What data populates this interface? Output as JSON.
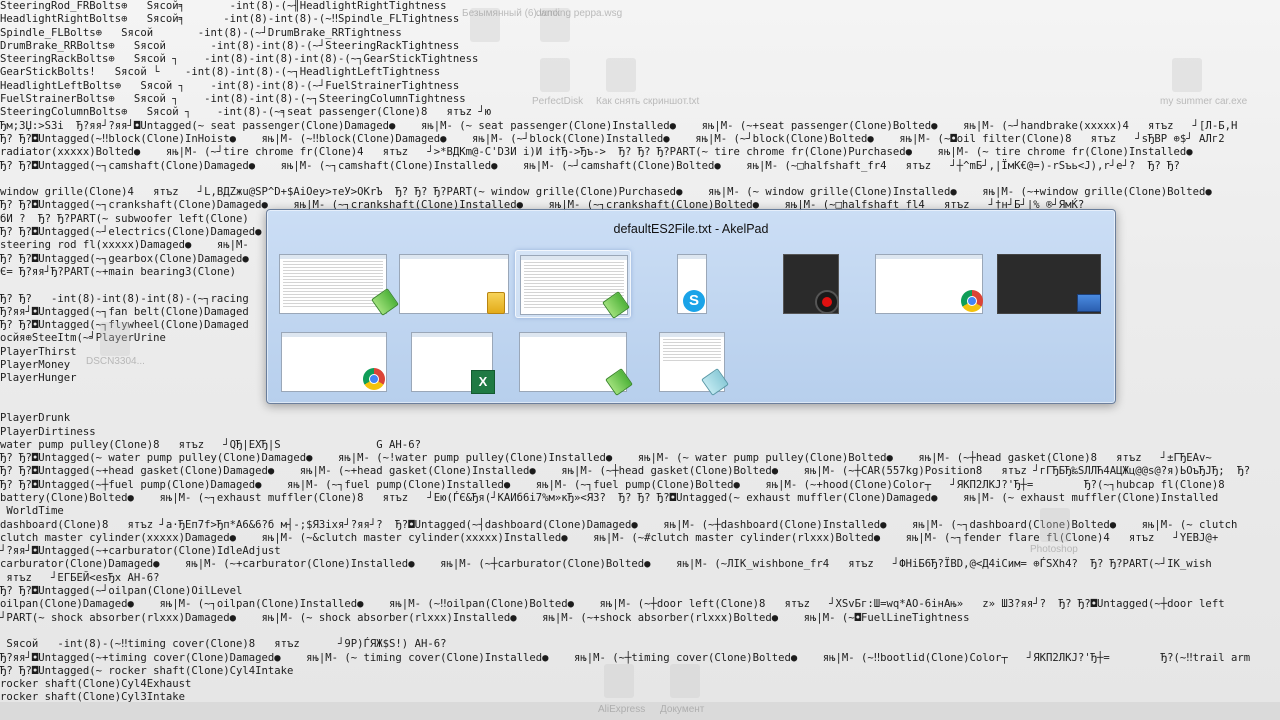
{
  "editor": {
    "lines": [
      "SteeringRod_FRBolts⊕   Ѕясой╕       -int(8)-(~╢HeadlightRightTightness",
      "HeadlightRightBolts⊕   Ѕясой╕      -int(8)-int(8)-(~‼Spindle_FLTightness",
      "Spindle_FLBolts⊕   Ѕясой       -int(8)-(~┘DrumBrake_RRTightness",
      "DrumBrake_RRBolts⊕   Ѕясой       -int(8)-int(8)-(~┘SteeringRackTightness",
      "SteeringRackBolts⊕   Ѕясой ┐    -int(8)-int(8)-int(8)-(~┐GearStickTightness",
      "GearStickBolts!   Ѕясой └    -int(8)-int(8)-(~┐HeadlightLeftTightness",
      "HeadlightLeftBolts⊕   Ѕясой ┐    -int(8)-int(8)-(~┘FuelStrainerTightness",
      "FuelStrainerBolts⊕   Ѕясой ┐    -int(8)-int(8)-(~┐SteeringColumnTightness",
      "SteeringColumnBolts⊕   Ѕясой ┐    -int(8)-(~╕seat passenger(Clone)8   ятъz ┘ю",
      "Ђм;3Џ:>Ѕ3і  Ђ?яя┘?яя┘◘Untagged(~ seat passenger(Clone)Damaged●    яњ|M- (~ seat passenger(Clone)Installed●    яњ|M- (~+seat passenger(Clone)Bolted●    яњ|M- (~┘handbrake(xxxxx)4   ятъz   ┘[Л-Б,Н",
      "Ђ? Ђ?◘Untagged(~‼block(Clone)InHoist●    яњ|M- (~‼block(Clone)Damaged●    яњ|M- (~┘block(Clone)Installed●    яњ|M- (~┘block(Clone)Bolted●    яњ|M- (~◘oil filter(Clone)8   ятъz   ┘ѕЂВР ⊕$┘ АЛг2",
      "radiator(xxxxx)Bolted●    яњ|M- (~┘tire chrome fr(Clone)4   ятъz   ┘>*ВДКm@-C'D3И і)И і†Ђ->Ђъ->  Ђ? Ђ? Ђ?PART(~ tire chrome fr(Clone)Purchased●    яњ|M- (~ tire chrome fr(Clone)Installed●",
      "Ђ? Ђ?◘Untagged(~┐camshaft(Clone)Damaged●    яњ|M- (~┐camshaft(Clone)Installed●    яњ|M- (~┘camshaft(Clone)Bolted●    яњ|M- (~□halfshaft_fr4   ятъz   ┘┼^mБ┘,|ЇмК€@=)-rЅъь<J),r┘e┘?  Ђ? Ђ?",
      "",
      "window grille(Clone)4   ятъz   ┘L,ВДZжu@SP^D+$АіОеу>теУ>ОКrЪ  Ђ? Ђ? Ђ?PART(~ window grille(Clone)Purchased●    яњ|M- (~ window grille(Clone)Installed●    яњ|M- (~+window grille(Clone)Bolted●",
      "Ђ? Ђ?◘Untagged(~┐crankshaft(Clone)Damaged●    яњ|M- (~┐crankshaft(Clone)Installed●    яњ|M- (~┐crankshaft(Clone)Bolted●    яњ|M- (~□halfshaft_fl4   ятъz   ┘†н┘Б┘|% ®┘ЯмЌ?",
      "бИ ?  Ђ? Ђ?PART(~ subwoofer left(Clone)",
      "Ђ? Ђ?◘Untagged(~┘electrics(Clone)Damaged●",
      "steering rod fl(xxxxx)Damaged●    яњ|M-",
      "Ђ? Ђ?◘Untagged(~┐gearbox(Clone)Damaged●",
      "Є= Ђ?яя┘Ђ?PART(~+main bearing3(Clone)",
      "",
      "Ђ? Ђ?   -int(8)-int(8)-int(8)-(~┐racing",
      "Ђ?яя┘◘Untagged(~┐fan belt(Clone)Damaged",
      "Ђ? Ђ?◘Untagged(~┐flywheel(Clone)Damaged",
      "осйя⊕SteeІtm(~╛PlayerUrine",
      "PlayerThirst",
      "PlayerMoney",
      "PlayerHunger",
      "",
      "",
      "PlayerDrunk",
      "PlayerDirtiness",
      "water pump pulley(Clone)8   ятъz   ┘QЂ|EXЂ|S               G AH-6?",
      "Ђ? Ђ?◘Untagged(~ water pump pulley(Clone)Damaged●    яњ|M- (~!water pump pulley(Clone)Installed●    яњ|M- (~ water pump pulley(Clone)Bolted●    яњ|M- (~┼head gasket(Clone)8   ятъz   ┘±ГЂЕАv~",
      "Ђ? Ђ?◘Untagged(~+head gasket(Clone)Damaged●    яњ|M- (~+head gasket(Clone)Installed●    яњ|M- (~┼head gasket(Clone)Bolted●    яњ|M- (~┼CAR(557kg)Position8   ятъz ┘гГЂБЂ‰ЅЛЛЋ4АЦЖц@@s@?я)ЬОъЂЈЂ;  Ђ?",
      "Ђ? Ђ?◘Untagged(~┼fuel pump(Clone)Damaged●    яњ|M- (~┐fuel pump(Clone)Installed●    яњ|M- (~┐fuel pump(Clone)Bolted●    яњ|M- (~+hood(Clone)Color┬   ┘ЯКП2ЛКЈ?'Ђ┼=        Ђ?(~┐hubcap fl(Clone)8",
      "battery(Clone)Bolted●    яњ|M- (~┐exhaust muffler(Clone)8   ятъz   ┘Eю(ЃЄ&Ђя(┘КАИб6і7%м»кЂ»<ЯЗ?  Ђ? Ђ? Ђ?◘Untagged(~ exhaust muffler(Clone)Damaged●    яњ|M- (~ exhaust muffler(Clone)Installed",
      " WorldTime",
      "dashboard(Clone)8   ятъz ┘a·ЂЕп7f>Ђп*А6&6?б м┤-;$Я3іхя┘?яя┘?  Ђ?◘Untagged(~┤dashboard(Clone)Damaged●    яњ|M- (~┼dashboard(Clone)Installed●    яњ|M- (~┐dashboard(Clone)Bolted●    яњ|M- (~ clutch",
      "clutch master cylinder(xxxxx)Damaged●    яњ|M- (~&clutch master cylinder(xxxxx)Installed●    яњ|M- (~#clutch master cylinder(rlxxx)Bolted●    яњ|M- (~┐fender flare fl(Clone)4   ятъz   ┘YЕВЈ@+",
      "┘?яя┘◘Untagged(~+carburator(Clone)IdleAdjust",
      "carburator(Clone)Damaged●    яњ|M- (~+carburator(Clone)Installed●    яњ|M- (~┼carburator(Clone)Bolted●    яњ|M- (~ЛІК_wishbone_fr4   ятъz   ┘ФНіБ6Ђ?ЇВD,@<Д4іСим= ⊕ЃЅХh4?  Ђ? Ђ?PART(~┘IK_wish",
      " ятъz   ┘ЕГБЕЙ<еsЂх AH-6?",
      "Ђ? Ђ?◘Untagged(~┘oilpan(Clone)OilLevel",
      "oilpan(Clone)Damaged●    яњ|M- (~┐oilpan(Clone)Installed●    яњ|M- (~‼oilpan(Clone)Bolted●    яњ|M- (~┼door left(Clone)8   ятъz   ┘ХЅvБг:Ш=wq*АО-6інАњ»   z» Ш3?яя┘?  Ђ? Ђ?◘Untagged(~┼door left",
      "┘PART(~ shock absorber(rlxxx)Damaged●    яњ|M- (~ shock absorber(rlxxx)Installed●    яњ|M- (~+shock absorber(rlxxx)Bolted●    яњ|M- (~◘FuelLineTightness",
      "",
      " Ѕясой   -int(8)-(~‼timing cover(Clone)8   ятъz      ┘9P)ЃЯЖ$S!) AH-6?",
      "Ђ?яя┘◘Untagged(~+timing cover(Clone)Damaged●    яњ|M- (~ timing cover(Clone)Installed●    яњ|M- (~┼timing cover(Clone)Bolted●    яњ|M- (~‼bootlid(Clone)Color┬   ┘ЯКП2ЛКЈ?'Ђ┼=        Ђ?(~‼trail arm",
      "Ђ? Ђ?◘Untagged(~ rocker shaft(Clone)Cyl4Intake",
      "rocker shaft(Clone)Cyl4Exhaust",
      "rocker shaft(Clone)Cyl3Intake",
      ""
    ]
  },
  "desktop_ghosts": [
    {
      "label": "Безымянный (6).wmk"
    },
    {
      "label": "dancing peppa.wsg"
    },
    {
      "label": "my summer car.exe"
    },
    {
      "label": "PerfectDisk"
    },
    {
      "label": "Как снять скриншот.txt"
    },
    {
      "label": "DSCN3304..."
    },
    {
      "label": "Photoshop"
    },
    {
      "label": "AliExpress"
    },
    {
      "label": "Документ"
    }
  ],
  "switcher": {
    "title": "defaultES2File.txt - AkelPad",
    "windows": [
      {
        "name": "akelpad-window-1",
        "badge": "notepad-icon"
      },
      {
        "name": "explorer-window",
        "badge": "folder-icon"
      },
      {
        "name": "akelpad-window-2",
        "badge": "notepad-icon",
        "selected": true
      },
      {
        "name": "skype-window",
        "badge": "skype-icon",
        "badge_text": "S"
      },
      {
        "name": "recorder-window",
        "badge": "record-icon"
      },
      {
        "name": "chrome-window-1",
        "badge": "chrome-icon"
      },
      {
        "name": "desktop-window",
        "badge": "desktop-icon"
      },
      {
        "name": "chrome-window-2",
        "badge": "chrome-icon"
      },
      {
        "name": "excel-window",
        "badge": "excel-icon",
        "badge_text": "X"
      },
      {
        "name": "akelpad-window-3",
        "badge": "notepad-icon"
      },
      {
        "name": "notepad-window",
        "badge": "notepad-icon"
      }
    ]
  },
  "colors": {
    "switcher_bg": "#b8d0ee",
    "record_red": "#e01010",
    "skype_blue": "#1aa3e8",
    "excel_green": "#1f7a43"
  }
}
